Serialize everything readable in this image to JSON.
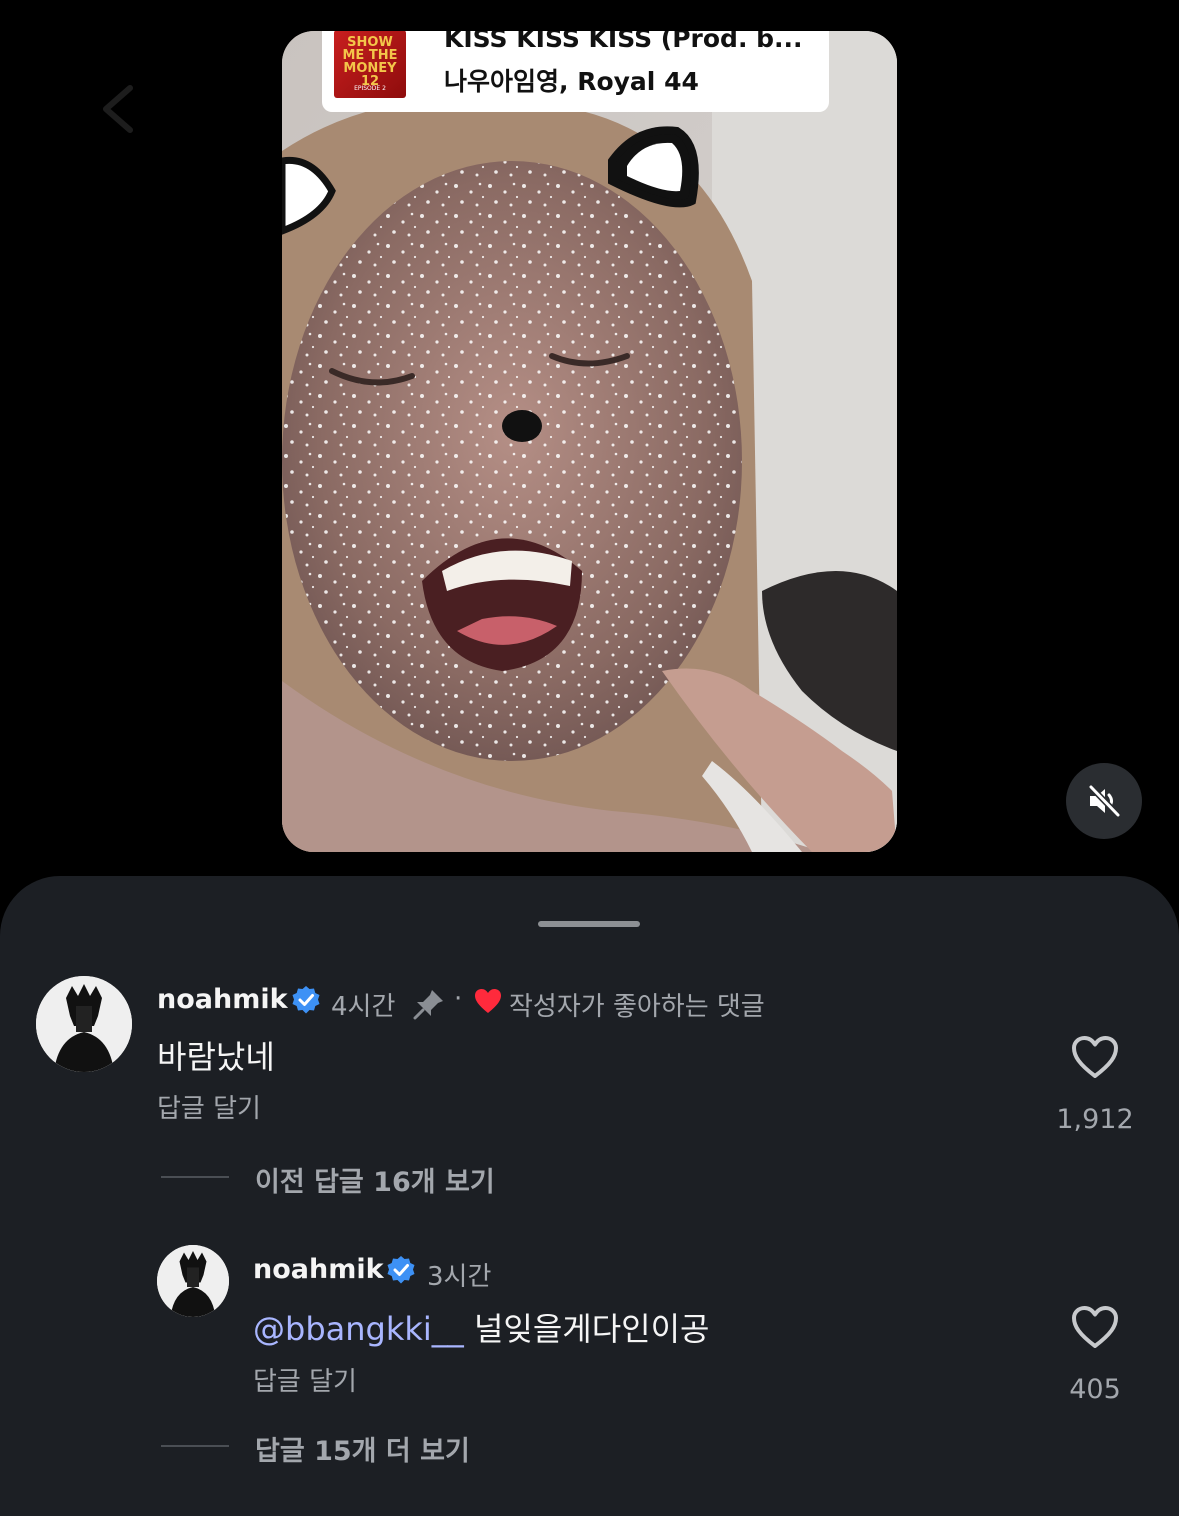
{
  "video": {
    "music": {
      "title": "KISS KISS KISS (Prod. b...",
      "artist": "나우아임영, Royal 44",
      "album_art_text": "SHOW ME THE MONEY 12",
      "album_art_sub": "EPISODE 2"
    },
    "mute_icon": "speaker-muted-icon"
  },
  "comments": [
    {
      "username": "noahmik",
      "verified": true,
      "time": "4시간",
      "pinned": true,
      "separator": "·",
      "creator_liked": "작성자가 좋아하는 댓글",
      "text": "바람났네",
      "reply_label": "답글 달기",
      "like_count": "1,912",
      "view_replies": "이전 답글 16개 보기"
    }
  ],
  "replies": [
    {
      "username": "noahmik",
      "verified": true,
      "time": "3시간",
      "mention": "@bbangkki__",
      "text": " 널잊을게다인이공",
      "reply_label": "답글 달기",
      "like_count": "405",
      "more_replies": "답글 15개 더 보기"
    }
  ],
  "colors": {
    "sheet_bg": "#1c1f24",
    "verified_blue": "#3d91f5",
    "heart_red": "#ff2a3c",
    "mention": "#a9b6ff"
  }
}
